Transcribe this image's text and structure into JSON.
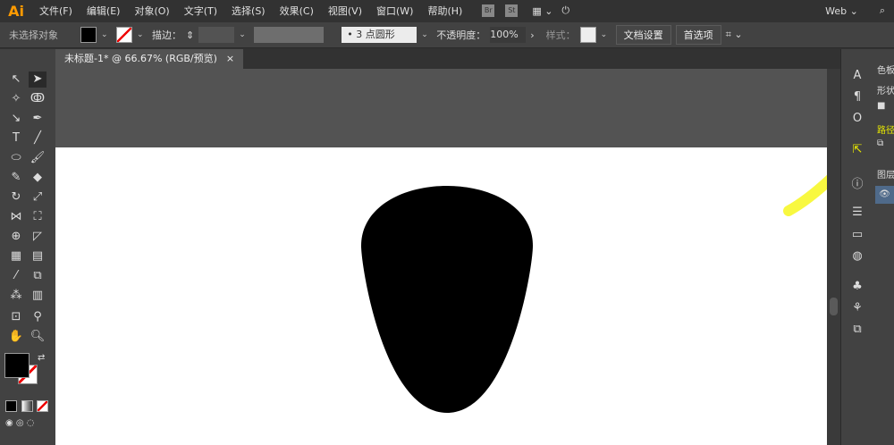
{
  "app": {
    "logo": "Ai",
    "workspace": "Web",
    "bridge": "Br",
    "stock": "St"
  },
  "menu": [
    "文件(F)",
    "编辑(E)",
    "对象(O)",
    "文字(T)",
    "选择(S)",
    "效果(C)",
    "视图(V)",
    "窗口(W)",
    "帮助(H)"
  ],
  "control": {
    "selection": "未选择对象",
    "stroke_label": "描边：",
    "brush": "3 点圆形",
    "opacity_label": "不透明度：",
    "opacity": "100%",
    "style_label": "样式：",
    "doc_setup": "文档设置",
    "preferences": "首选项"
  },
  "tab": {
    "title": "未标题-1* @ 66.67% (RGB/预览)",
    "close": "×"
  },
  "right_panel": {
    "swatches": "色板",
    "shape": "形状",
    "path": "路径",
    "layers": "图层"
  },
  "colors": {
    "accent": "#ffff00",
    "fill": "#000000"
  }
}
